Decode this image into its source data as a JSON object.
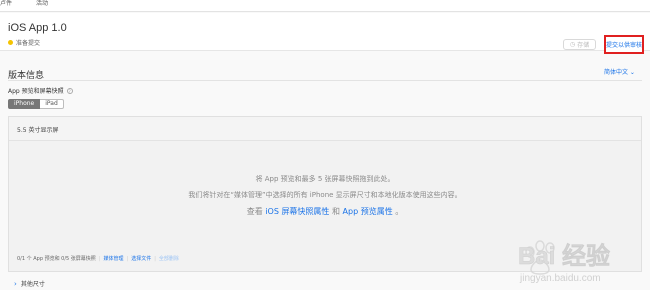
{
  "topnav": {
    "tab1": "卢件",
    "tab2": "活动"
  },
  "header": {
    "app_title": "iOS App 1.0",
    "status": "准备提交",
    "save_label": "存储",
    "submit_label": "提交以供审核"
  },
  "version": {
    "section_title": "版本信息",
    "language": "简体中文 ⌄",
    "preview_label": "App 预览和屏幕快照",
    "devices": [
      "iPhone",
      "iPad"
    ],
    "panel_title": "5.5 英寸显示屏",
    "drop_line1": "将 App 预览和最多 5 张屏幕快照拖到此处。",
    "drop_line2": "我们将针对在“媒体管理”中选择的所有 iPhone 显示屏尺寸和本地化版本使用这些内容。",
    "drop_line3_prefix": "查看",
    "drop_line3_link1": "iOS 屏幕快照属性",
    "drop_line3_mid": "和",
    "drop_line3_link2": "App 预览属性",
    "drop_line3_suffix": "。",
    "footer_count": "0/1 个 App 预览和 0/5 张屏幕快照",
    "footer_media": "媒体管理",
    "footer_choose": "选择文件",
    "footer_delete": "全部删除",
    "other_sizes": "其他尺寸"
  },
  "watermark": {
    "brand": "Bai 经验",
    "url": "jingyan.baidu.com"
  },
  "colors": {
    "accent": "#1a73e8",
    "highlight": "#e02020",
    "status": "#f4c300"
  }
}
